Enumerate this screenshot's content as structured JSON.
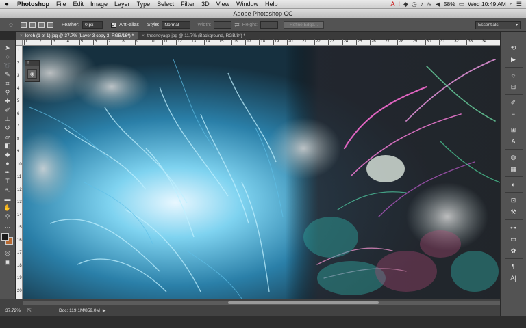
{
  "menubar": {
    "apple": "",
    "items": [
      "Photoshop",
      "File",
      "Edit",
      "Image",
      "Layer",
      "Type",
      "Select",
      "Filter",
      "3D",
      "View",
      "Window",
      "Help"
    ],
    "battery": "58%",
    "clock": "Wed 10:49 AM"
  },
  "window_title": "Adobe Photoshop CC",
  "options": {
    "feather_label": "Feather:",
    "feather_value": "0 px",
    "antialias_label": "Anti-alias",
    "style_label": "Style:",
    "style_value": "Normal",
    "width_label": "Width:",
    "height_label": "Height:",
    "refine_edge": "Refine Edge...",
    "workspace": "Essentials"
  },
  "tabs": [
    {
      "label": "loreh (1 of 1).jpg @ 37.7% (Layer 3 copy 3, RGB/16*) *",
      "active": true
    },
    {
      "label": "thecnoyage.jpg @ 11.7% (Background, RGB/8*) *",
      "active": false
    }
  ],
  "ruler": {
    "h_ticks": [
      "1",
      "2",
      "3",
      "4",
      "5",
      "6",
      "7",
      "8",
      "9",
      "10",
      "11",
      "12",
      "13",
      "14",
      "15",
      "16",
      "17",
      "18",
      "19",
      "20",
      "21",
      "22",
      "23",
      "24",
      "25",
      "26",
      "27",
      "28",
      "29",
      "30",
      "31",
      "32",
      "33",
      "34"
    ],
    "v_ticks": [
      "1",
      "2",
      "3",
      "4",
      "5",
      "6",
      "7",
      "8",
      "9",
      "10",
      "11",
      "12",
      "13",
      "14",
      "15",
      "16",
      "17",
      "18",
      "19",
      "20"
    ]
  },
  "status": {
    "zoom": "37.72%",
    "doc": "Doc: 119.1M/859.0M"
  },
  "colors": {
    "foreground": "#1a1a1a",
    "background": "#b76a32"
  }
}
